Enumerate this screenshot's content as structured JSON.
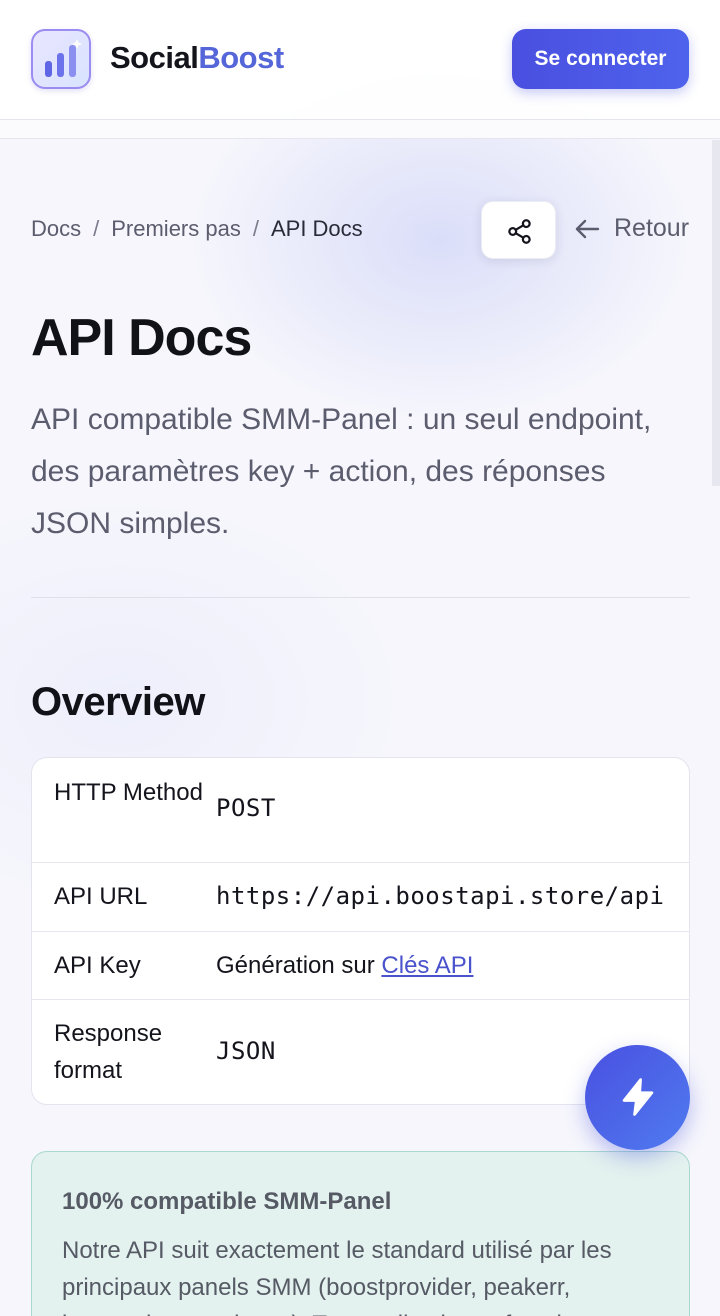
{
  "header": {
    "brand_part1": "Social",
    "brand_part2": "Boost",
    "login_label": "Se connecter",
    "colors": {
      "brand_accent": "#5566d8",
      "button": "#4a4fe0"
    }
  },
  "breadcrumb": {
    "items": [
      "Docs",
      "Premiers pas",
      "API Docs"
    ],
    "separator": "/"
  },
  "actions": {
    "share_icon": "share-icon",
    "back_label": "Retour"
  },
  "page": {
    "title": "API Docs",
    "intro": "API compatible SMM-Panel : un seul endpoint, des paramètres key + action, des réponses JSON simples."
  },
  "overview": {
    "title": "Overview",
    "rows": [
      {
        "key": "HTTP Method",
        "value": "POST"
      },
      {
        "key": "API URL",
        "value": "https://api.boostapi.store/api"
      },
      {
        "key": "API Key",
        "value_prefix": "Génération sur ",
        "link": "Clés API"
      },
      {
        "key": "Response format",
        "value": "JSON"
      }
    ]
  },
  "callout": {
    "title": "100% compatible SMM-Panel",
    "text": "Notre API suit exactement le standard utilisé par les principaux panels SMM (boostprovider, peakerr, justanotherpanel, etc.). Tout outil existant fonctionne"
  },
  "fab": {
    "icon": "lightning-icon"
  }
}
